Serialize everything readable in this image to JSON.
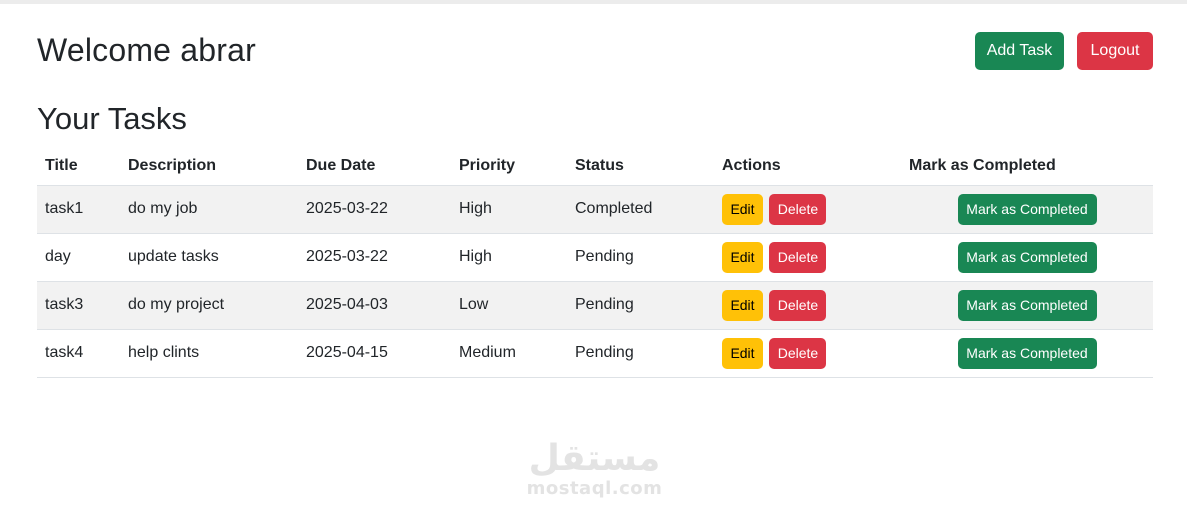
{
  "header": {
    "welcome": "Welcome abrar",
    "add_task_label": "Add Task",
    "logout_label": "Logout"
  },
  "tasks_section": {
    "title": "Your Tasks"
  },
  "table": {
    "columns": [
      "Title",
      "Description",
      "Due Date",
      "Priority",
      "Status",
      "Actions",
      "Mark as Completed"
    ],
    "rows": [
      {
        "title": "task1",
        "description": "do my job",
        "due_date": "2025-03-22",
        "priority": "High",
        "status": "Completed"
      },
      {
        "title": "day",
        "description": "update tasks",
        "due_date": "2025-03-22",
        "priority": "High",
        "status": "Pending"
      },
      {
        "title": "task3",
        "description": "do my project",
        "due_date": "2025-04-03",
        "priority": "Low",
        "status": "Pending"
      },
      {
        "title": "task4",
        "description": "help clints",
        "due_date": "2025-04-15",
        "priority": "Medium",
        "status": "Pending"
      }
    ],
    "edit_label": "Edit",
    "delete_label": "Delete",
    "mark_label": "Mark as Completed"
  },
  "watermark": {
    "logo": "مستقل",
    "text": "mostaql.com"
  },
  "colors": {
    "success": "#198754",
    "danger": "#dc3545",
    "warning": "#ffc107"
  }
}
